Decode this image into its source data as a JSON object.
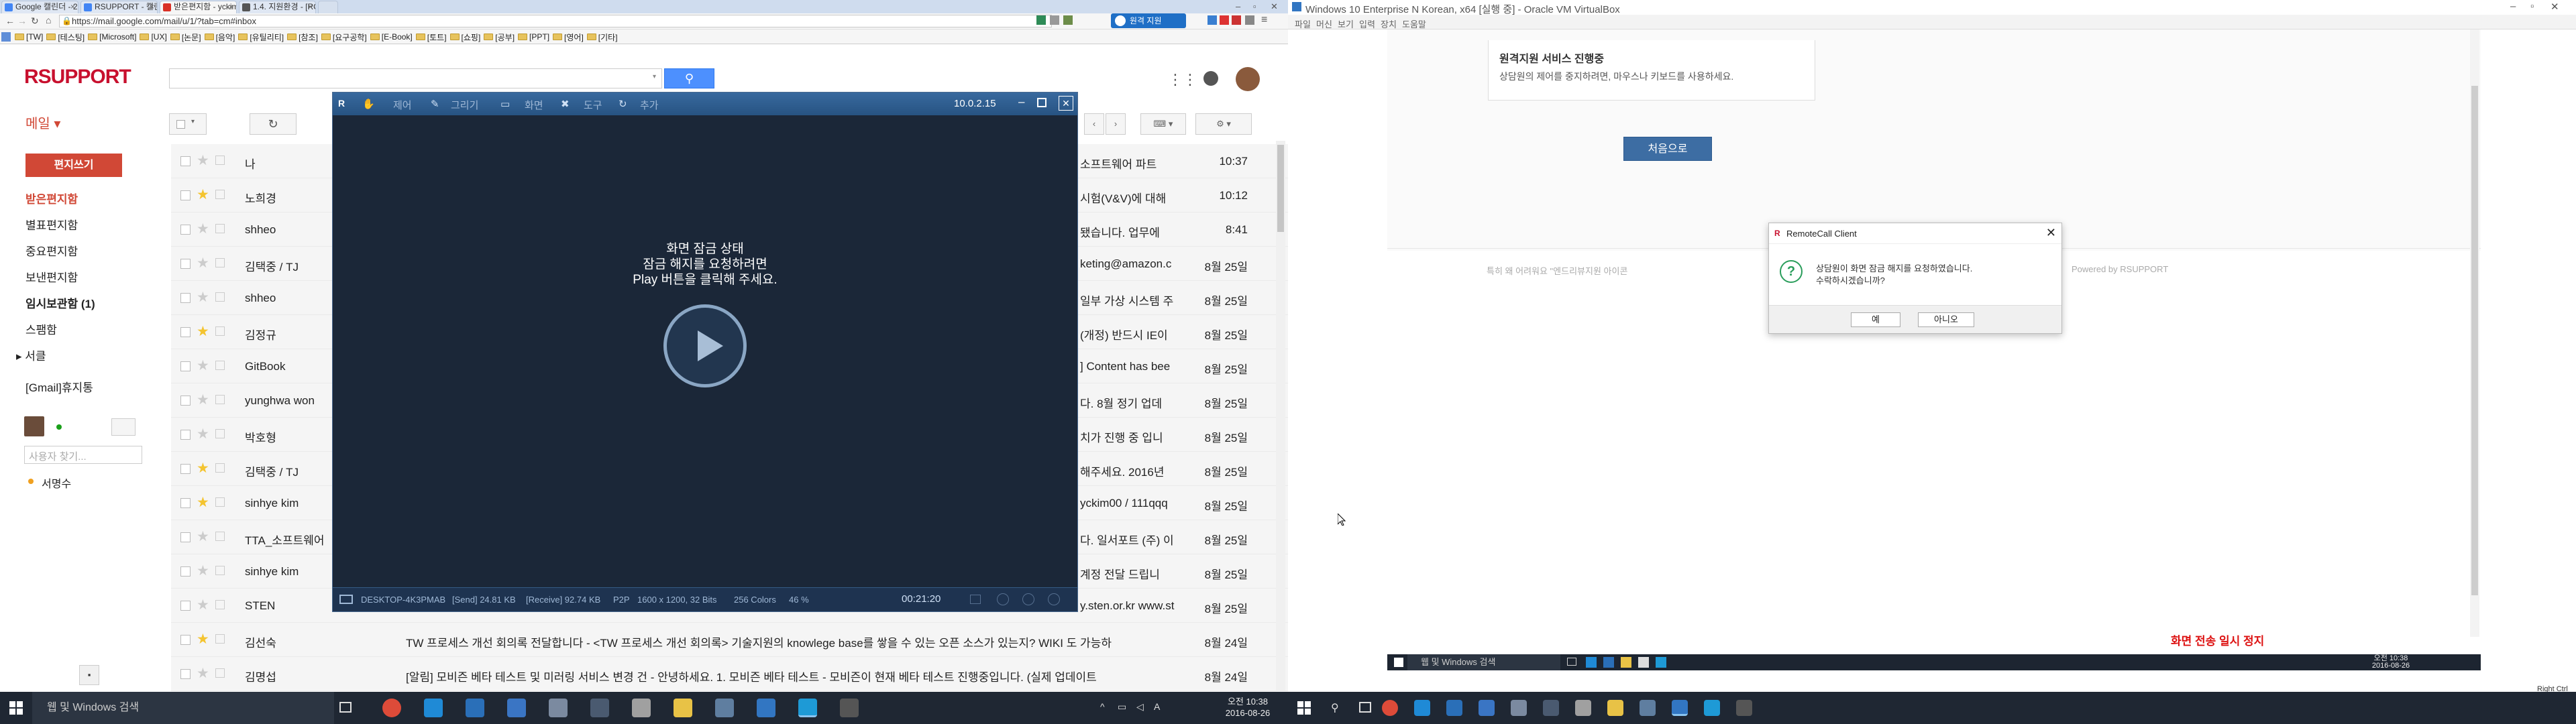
{
  "chrome": {
    "tabs": [
      {
        "label": "Google 캘린더 - 20",
        "fav": "#4285f4"
      },
      {
        "label": "RSUPPORT - 캘린더",
        "fav": "#4285f4"
      },
      {
        "label": "받은편지함 - yckim",
        "fav": "#d93025"
      },
      {
        "label": "1.4. 지원환경 - [RC",
        "fav": "#555555"
      }
    ],
    "url": "https://mail.google.com/mail/u/1/?tab=cm#inbox",
    "bookmarks": [
      "[TW]",
      "[테스팅]",
      "[Microsoft]",
      "[UX]",
      "[논문]",
      "[음악]",
      "[유틸리티]",
      "[참조]",
      "[요구공학]",
      "[E-Book]",
      "[토트]",
      "[쇼핑]",
      "[공부]",
      "[PPT]",
      "[영어]",
      "[기타]"
    ],
    "ext_badge": "원격 지원"
  },
  "gmail": {
    "logo": "RSUPPORT",
    "mail_label": "메일 ▾",
    "compose": "편지쓰기",
    "nav": [
      "받은편지함",
      "별표편지함",
      "중요편지함",
      "보낸편지함",
      "임시보관함 (1)",
      "스팸함",
      "▸ 서클",
      "[Gmail]휴지통"
    ],
    "people_search_placeholder": "사용자 찾기...",
    "contact": "서명수",
    "rows": [
      {
        "sender": "나",
        "subject": "",
        "tail": "소프트웨어 파트",
        "date": "10:37",
        "star": false
      },
      {
        "sender": "노희경",
        "subject": "",
        "tail": "시험(V&V)에 대해",
        "date": "10:12",
        "star": true
      },
      {
        "sender": "shheo",
        "subject": "",
        "tail": "됐습니다. 업무에",
        "date": "8:41",
        "star": false
      },
      {
        "sender": "김택중 / TJ",
        "subject": "",
        "tail": "keting@amazon.c",
        "date": "8월 25일",
        "star": false
      },
      {
        "sender": "shheo",
        "subject": "",
        "tail": "일부 가상 시스템 주",
        "date": "8월 25일",
        "star": false
      },
      {
        "sender": "김정규",
        "subject": "",
        "tail": "(개정) 반드시 IE이",
        "date": "8월 25일",
        "star": true
      },
      {
        "sender": "GitBook",
        "subject": "",
        "tail": "] Content has bee",
        "date": "8월 25일",
        "star": false
      },
      {
        "sender": "yunghwa won",
        "subject": "",
        "tail": "다. 8월 정기 업데",
        "date": "8월 25일",
        "star": false
      },
      {
        "sender": "박호형",
        "subject": "",
        "tail": "치가 진행 중 입니",
        "date": "8월 25일",
        "star": false
      },
      {
        "sender": "김택중 / TJ",
        "subject": "",
        "tail": "해주세요. 2016년",
        "date": "8월 25일",
        "star": true
      },
      {
        "sender": "sinhye kim",
        "subject": "",
        "tail": "yckim00 / 111qqq",
        "date": "8월 25일",
        "star": true
      },
      {
        "sender": "TTA_소프트웨어",
        "subject": "",
        "tail": "다. 일서포트 (주) 이",
        "date": "8월 25일",
        "star": false
      },
      {
        "sender": "sinhye kim",
        "subject": "",
        "tail": "계정 전달 드립니",
        "date": "8월 25일",
        "star": false
      },
      {
        "sender": "STEN",
        "subject": "",
        "tail": "y.sten.or.kr www.st",
        "date": "8월 25일",
        "star": false
      },
      {
        "sender": "김선숙",
        "subject": "TW 프로세스 개선 회의록 전달합니다 - <TW 프로세스 개선 회의록> 기술지원의 knowlege base를 쌓을 수 있는 오픈 소스가 있는지? WIKI 도 가능하",
        "tail": "",
        "date": "8월 24일",
        "star": true
      },
      {
        "sender": "김명섭",
        "subject": "[알림] 모비즌 베타 테스트 및 미러링 서비스 변경 건 - 안녕하세요. 1. 모비즌 베타 테스트 - 모비즌이 현재 베타 테스트 진행중입니다. (실제 업데이트",
        "tail": "",
        "date": "8월 24일",
        "star": false
      }
    ]
  },
  "viewer": {
    "toolbar": [
      "제어",
      "그리기",
      "화면",
      "도구",
      "추가"
    ],
    "ip": "10.0.2.15",
    "lock_title": "화면 잠금 상태",
    "lock_line2": "잠금 해지를 요청하려면",
    "lock_line3": "Play 버튼을 클릭해 주세요.",
    "status_host": "DESKTOP-4K3PMAB",
    "status_send": "[Send] 24.81 KB",
    "status_receive": "[Receive] 92.74 KB",
    "status_mode": "P2P",
    "status_res": "1600 x 1200, 32 Bits",
    "status_colors": "256 Colors",
    "status_pct": "46 %",
    "timer": "00:21:20"
  },
  "left_taskbar": {
    "search": "웹 및 Windows 검색",
    "time": "오전 10:38",
    "date": "2016-08-26"
  },
  "vbox": {
    "title": "Windows 10 Enterprise N Korean, x64 [실행 중] - Oracle VM VirtualBox",
    "menu": [
      "파일",
      "머신",
      "보기",
      "입력",
      "장치",
      "도움말"
    ],
    "card_title": "원격지원 서비스 진행중",
    "card_text": "상담원의 제어를 중지하려면, 마우스나 키보드를 사용하세요.",
    "home_button": "처음으로",
    "footer_left": "특히 왜 어려워요 \"엔드리뷰지원 아이콘",
    "footer_right": "Powered by RSUPPORT",
    "dialog_title": "RemoteCall Client",
    "dialog_line1": "상담원이 화면 잠금 해지를 요청하였습니다.",
    "dialog_line2": "수락하시겠습니까?",
    "dialog_yes": "예",
    "dialog_no": "아니오",
    "paused_text": "화면 전송 일시 정지",
    "guest_search": "웹 및 Windows 검색",
    "guest_time": "오전 10:38",
    "guest_date": "2016-08-26",
    "host_key": "Right Ctrl"
  }
}
